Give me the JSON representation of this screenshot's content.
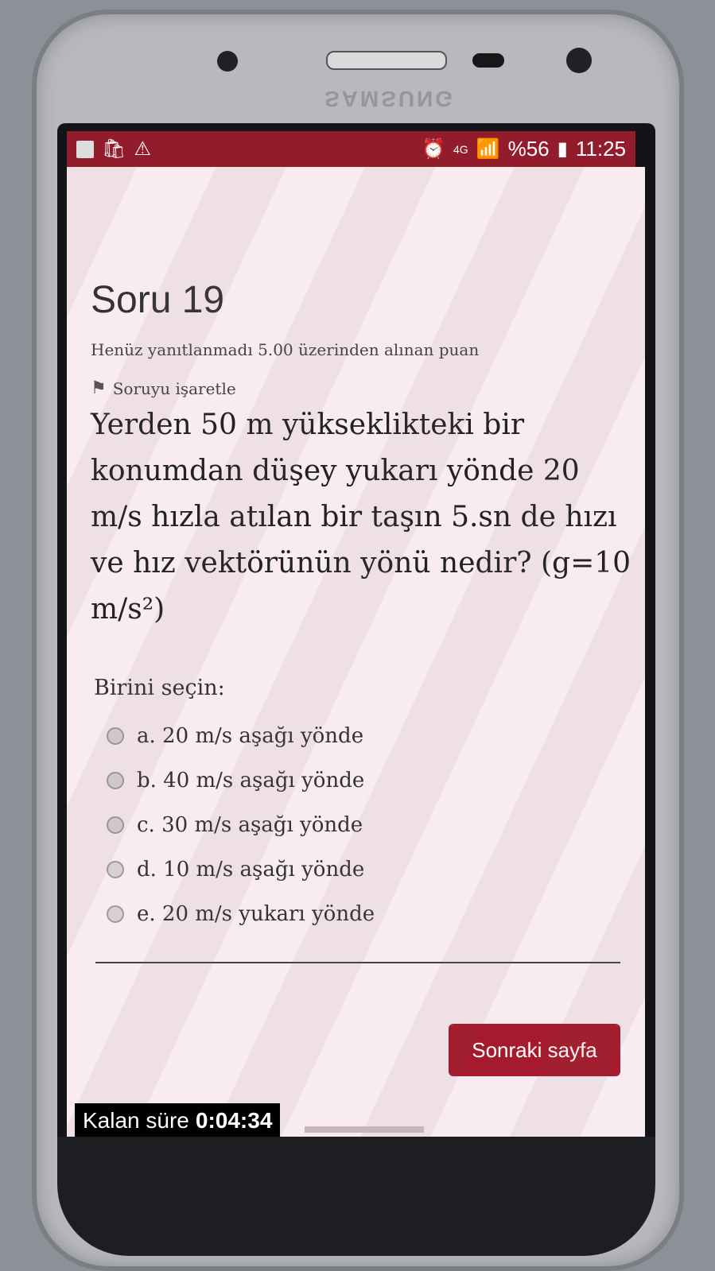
{
  "device": {
    "brand": "SAMSUNG"
  },
  "status_bar": {
    "left_icons": [
      "notification-icon",
      "store-icon",
      "warning-icon"
    ],
    "network": "4G",
    "battery": "%56",
    "time": "11:25"
  },
  "question": {
    "title": "Soru 19",
    "meta": "Henüz yanıtlanmadı  5.00 üzerinden alınan puan",
    "flag_label": "Soruyu işaretle",
    "text": "Yerden 50 m yükseklikteki bir konumdan düşey yukarı yönde 20 m/s hızla atılan bir taşın 5.sn de hızı ve hız vektörünün yönü nedir? (g=10 m/s²)",
    "prompt": "Birini seçin:",
    "answers": [
      "a. 20 m/s aşağı yönde",
      "b. 40 m/s aşağı yönde",
      "c. 30 m/s aşağı yönde",
      "d. 10 m/s aşağı yönde",
      "e. 20 m/s yukarı yönde"
    ]
  },
  "actions": {
    "next_page": "Sonraki sayfa"
  },
  "timer": {
    "label": "Kalan süre",
    "value": "0:04:34"
  },
  "colors": {
    "accent": "#a51a2c",
    "status_bar": "#931c2c"
  }
}
